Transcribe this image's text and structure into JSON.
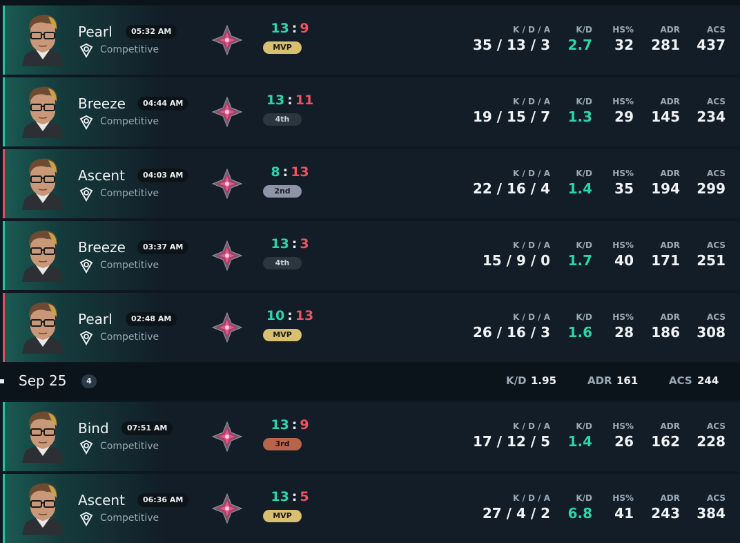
{
  "colors": {
    "win_accent": "#22c3a0",
    "loss_accent": "#e0505a",
    "score_ours": "#2ad6ae",
    "score_theirs": "#f0525e",
    "mvp_badge": "#d8c070",
    "silver_badge": "#8f93a8",
    "bronze_badge": "#b8644a",
    "dark_badge": "#2c363e"
  },
  "stat_headers": {
    "kda": "K / D / A",
    "kd": "K/D",
    "hs": "HS%",
    "adr": "ADR",
    "acs": "ACS"
  },
  "matches": [
    {
      "result": "win",
      "map": "Pearl",
      "time": "05:32 AM",
      "mode": "Competitive",
      "score_ours": "13",
      "score_theirs": "9",
      "placement": "MVP",
      "placement_style": "mvp",
      "kda": "35 / 13 / 3",
      "kd": "2.7",
      "hs": "32",
      "adr": "281",
      "acs": "437"
    },
    {
      "result": "win",
      "map": "Breeze",
      "time": "04:44 AM",
      "mode": "Competitive",
      "score_ours": "13",
      "score_theirs": "11",
      "placement": "4th",
      "placement_style": "dark",
      "kda": "19 / 15 / 7",
      "kd": "1.3",
      "hs": "29",
      "adr": "145",
      "acs": "234"
    },
    {
      "result": "loss",
      "map": "Ascent",
      "time": "04:03 AM",
      "mode": "Competitive",
      "score_ours": "8",
      "score_theirs": "13",
      "placement": "2nd",
      "placement_style": "silver",
      "kda": "22 / 16 / 4",
      "kd": "1.4",
      "hs": "35",
      "adr": "194",
      "acs": "299"
    },
    {
      "result": "win",
      "map": "Breeze",
      "time": "03:37 AM",
      "mode": "Competitive",
      "score_ours": "13",
      "score_theirs": "3",
      "placement": "4th",
      "placement_style": "dark",
      "kda": "15 / 9 / 0",
      "kd": "1.7",
      "hs": "40",
      "adr": "171",
      "acs": "251"
    },
    {
      "result": "loss",
      "map": "Pearl",
      "time": "02:48 AM",
      "mode": "Competitive",
      "score_ours": "10",
      "score_theirs": "13",
      "placement": "MVP",
      "placement_style": "mvp",
      "kda": "26 / 16 / 3",
      "kd": "1.6",
      "hs": "28",
      "adr": "186",
      "acs": "308"
    }
  ],
  "day_header": {
    "date": "Sep 25",
    "count": "4",
    "kd_label": "K/D",
    "kd_value": "1.95",
    "adr_label": "ADR",
    "adr_value": "161",
    "acs_label": "ACS",
    "acs_value": "244"
  },
  "matches_day2": [
    {
      "result": "win",
      "map": "Bind",
      "time": "07:51 AM",
      "mode": "Competitive",
      "score_ours": "13",
      "score_theirs": "9",
      "placement": "3rd",
      "placement_style": "bronze",
      "kda": "17 / 12 / 5",
      "kd": "1.4",
      "hs": "26",
      "adr": "162",
      "acs": "228"
    },
    {
      "result": "win",
      "map": "Ascent",
      "time": "06:36 AM",
      "mode": "Competitive",
      "score_ours": "13",
      "score_theirs": "5",
      "placement": "MVP",
      "placement_style": "mvp",
      "kda": "27 / 4 / 2",
      "kd": "6.8",
      "hs": "41",
      "adr": "243",
      "acs": "384"
    }
  ]
}
